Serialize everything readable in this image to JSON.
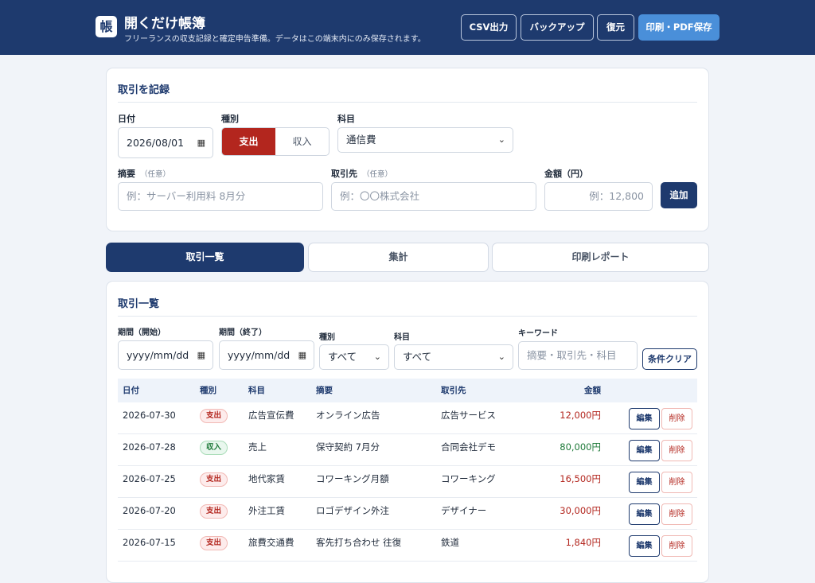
{
  "header": {
    "logo_char": "帳",
    "title": "開くだけ帳簿",
    "subtitle": "フリーランスの収支記録と確定申告準備。データはこの端末内にのみ保存されます。",
    "buttons": {
      "csv": "CSV出力",
      "backup": "バックアップ",
      "restore": "復元",
      "print": "印刷・PDF保存"
    }
  },
  "entry": {
    "title": "取引を記録",
    "date_label": "日付",
    "date_value": "2026/08/01",
    "type_label": "種別",
    "type_expense": "支出",
    "type_income": "収入",
    "account_label": "科目",
    "account_value": "通信費",
    "memo_label": "摘要",
    "memo_optional": "（任意）",
    "memo_placeholder": "例：サーバー利用料 8月分",
    "partner_label": "取引先",
    "partner_optional": "（任意）",
    "partner_placeholder": "例：〇〇株式会社",
    "amount_label": "金額（円）",
    "amount_placeholder": "例：12,800",
    "add_button": "追加"
  },
  "tabs": [
    "取引一覧",
    "集計",
    "印刷レポート"
  ],
  "list": {
    "title": "取引一覧",
    "filters": {
      "start_label": "期間（開始）",
      "end_label": "期間（終了）",
      "date_placeholder": "yyyy/mm/dd",
      "type_label": "種別",
      "type_value": "すべて",
      "account_label": "科目",
      "account_value": "すべて",
      "keyword_label": "キーワード",
      "keyword_placeholder": "摘要・取引先・科目",
      "clear_button": "条件クリア"
    },
    "columns": [
      "日付",
      "種別",
      "科目",
      "摘要",
      "取引先",
      "金額"
    ],
    "edit_label": "編集",
    "delete_label": "削除",
    "rows": [
      {
        "date": "2026-07-30",
        "type": "支出",
        "kind": "exp",
        "account": "広告宣伝費",
        "memo": "オンライン広告",
        "partner": "広告サービス",
        "amount": "12,000円"
      },
      {
        "date": "2026-07-28",
        "type": "収入",
        "kind": "inc",
        "account": "売上",
        "memo": "保守契約 7月分",
        "partner": "合同会社デモ",
        "amount": "80,000円"
      },
      {
        "date": "2026-07-25",
        "type": "支出",
        "kind": "exp",
        "account": "地代家賃",
        "memo": "コワーキング月額",
        "partner": "コワーキング",
        "amount": "16,500円"
      },
      {
        "date": "2026-07-20",
        "type": "支出",
        "kind": "exp",
        "account": "外注工賃",
        "memo": "ロゴデザイン外注",
        "partner": "デザイナー",
        "amount": "30,000円"
      },
      {
        "date": "2026-07-15",
        "type": "支出",
        "kind": "exp",
        "account": "旅費交通費",
        "memo": "客先打ち合わせ 往復",
        "partner": "鉄道",
        "amount": "1,840円"
      }
    ]
  },
  "colors": {
    "navy": "#1e3a6e",
    "accent": "#4a8fd9",
    "expense": "#b3261e",
    "income": "#1f7a3a"
  }
}
